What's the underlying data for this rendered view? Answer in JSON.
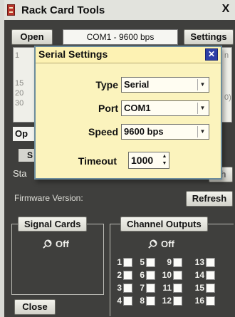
{
  "window": {
    "title": "Rack Card Tools",
    "close_glyph": "X"
  },
  "toolbar": {
    "open_label": "Open",
    "connection_display": "COM1 - 9600 bps",
    "settings_label": "Settings"
  },
  "background": {
    "list_numbers": [
      "1",
      "15",
      "20",
      "30"
    ],
    "list_col_right": "n",
    "list_tail": "0)",
    "op_text": "Op",
    "s_text": "S",
    "sta_text": "Sta",
    "sh_text": "sh",
    "firmware_label": "Firmware Version:",
    "refresh_label": "Refresh"
  },
  "signal_cards": {
    "title": "Signal Cards",
    "status": "Off",
    "status_icon": "power-plug-icon"
  },
  "channel_outputs": {
    "title": "Channel Outputs",
    "status": "Off",
    "status_icon": "power-plug-icon",
    "channels": [
      "1",
      "2",
      "3",
      "4",
      "5",
      "6",
      "7",
      "8",
      "9",
      "10",
      "11",
      "12",
      "13",
      "14",
      "15",
      "16"
    ]
  },
  "footer": {
    "close_label": "Close"
  },
  "dialog": {
    "title": "Serial Settings",
    "close_glyph": "✕",
    "type_label": "Type",
    "type_value": "Serial",
    "port_label": "Port",
    "port_value": "COM1",
    "speed_label": "Speed",
    "speed_value": "9600 bps",
    "timeout_label": "Timeout",
    "timeout_value": "1000"
  },
  "colors": {
    "dialog_bg": "#fbf3bd",
    "dialog_close_bg": "#2d3fa6",
    "window_bg": "#3f3f3d"
  }
}
